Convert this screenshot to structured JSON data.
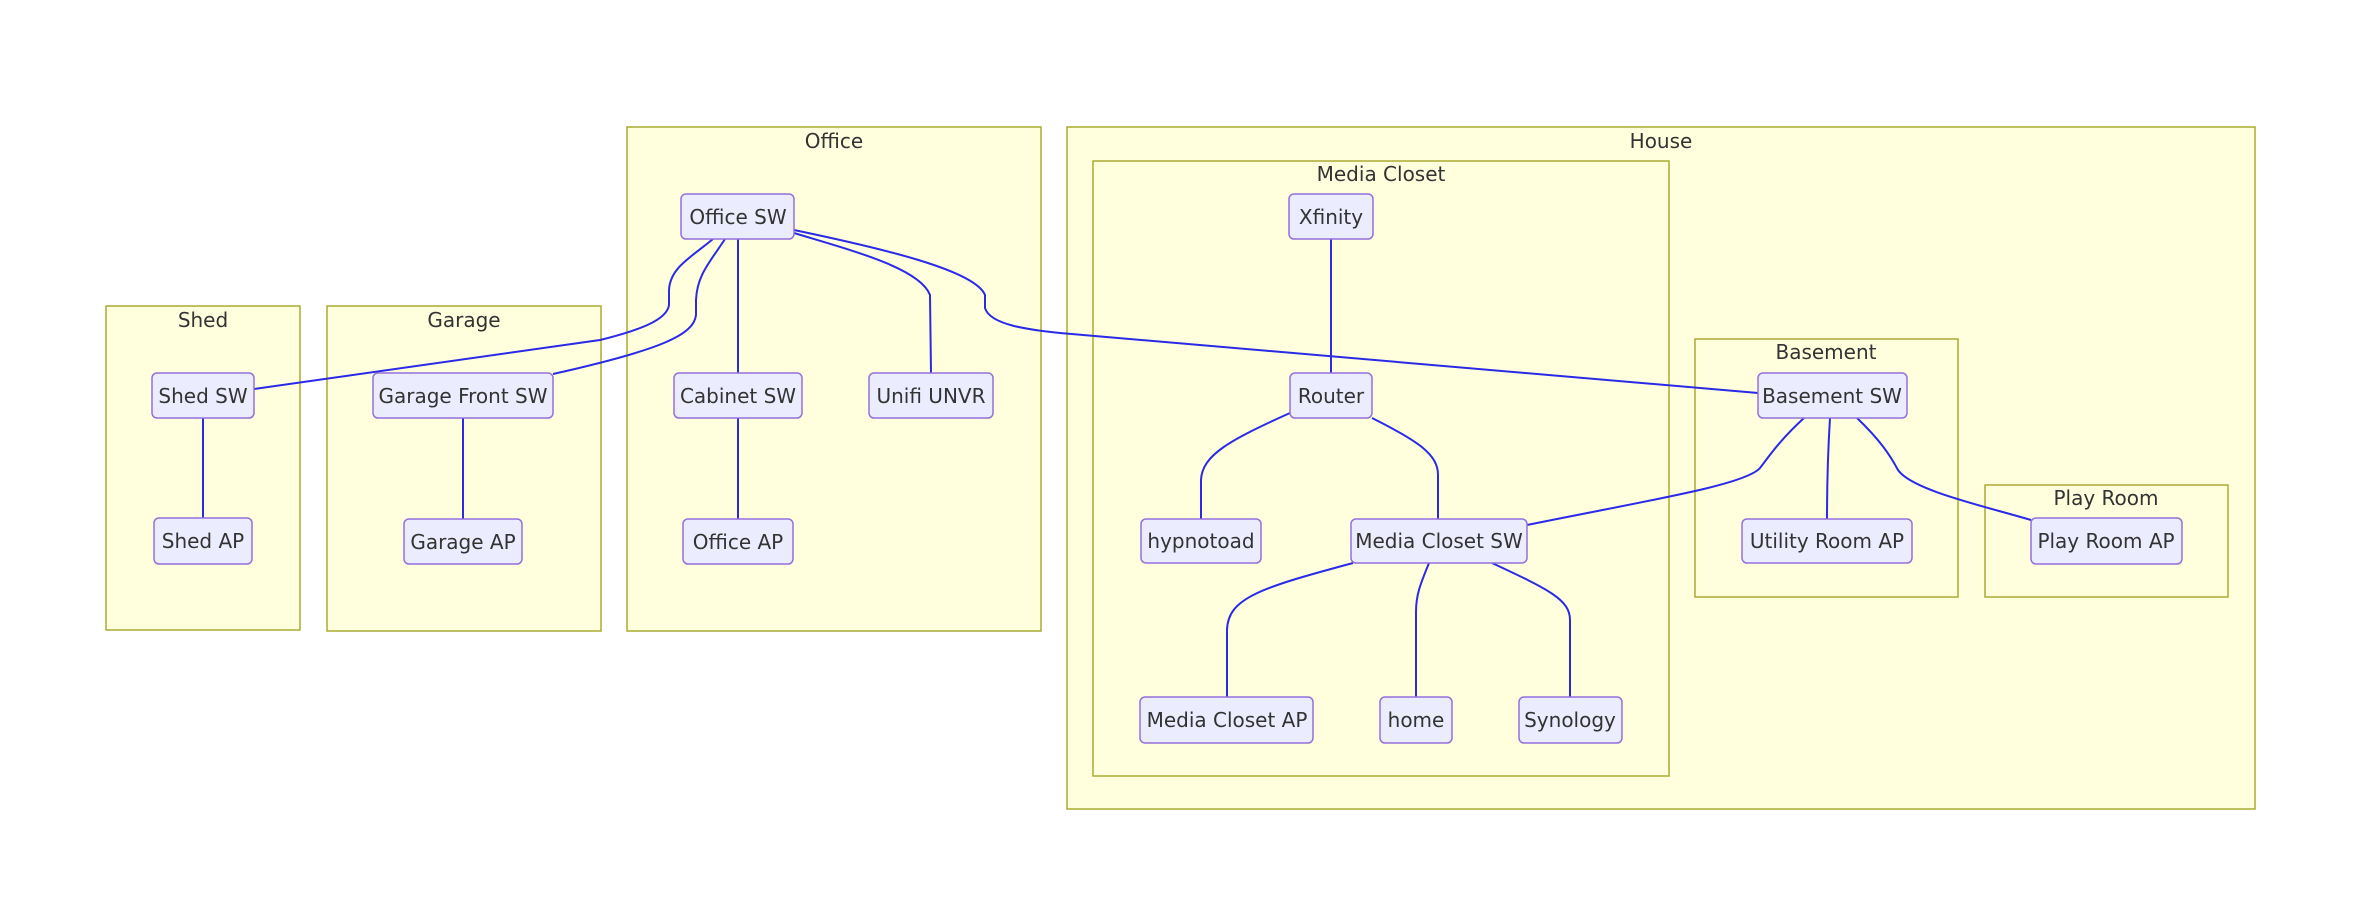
{
  "diagram": {
    "type": "flowchart",
    "colors": {
      "cluster_fill": "#ffffde",
      "cluster_stroke": "#aaaa33",
      "node_fill": "#ececff",
      "node_stroke": "#9370db",
      "edge": "#2a2ae6",
      "text": "#333333"
    },
    "clusters": {
      "shed": "Shed",
      "garage": "Garage",
      "office": "Office",
      "house": "House",
      "media_closet": "Media Closet",
      "basement": "Basement",
      "play_room": "Play Room"
    },
    "nodes": {
      "shed_sw": "Shed SW",
      "shed_ap": "Shed AP",
      "garage_front_sw": "Garage Front SW",
      "garage_ap": "Garage AP",
      "office_sw": "Office SW",
      "cabinet_sw": "Cabinet SW",
      "unifi_unvr": "Unifi UNVR",
      "office_ap": "Office AP",
      "xfinity": "Xfinity",
      "router": "Router",
      "hypnotoad": "hypnotoad",
      "media_closet_sw": "Media Closet SW",
      "media_closet_ap": "Media Closet AP",
      "home": "home",
      "synology": "Synology",
      "basement_sw": "Basement SW",
      "utility_room_ap": "Utility Room AP",
      "play_room_ap": "Play Room AP"
    },
    "edges": [
      {
        "from": "Office SW",
        "to": "Shed SW"
      },
      {
        "from": "Office SW",
        "to": "Garage Front SW"
      },
      {
        "from": "Office SW",
        "to": "Cabinet SW"
      },
      {
        "from": "Office SW",
        "to": "Unifi UNVR"
      },
      {
        "from": "Office SW",
        "to": "Basement SW"
      },
      {
        "from": "Shed SW",
        "to": "Shed AP"
      },
      {
        "from": "Garage Front SW",
        "to": "Garage AP"
      },
      {
        "from": "Cabinet SW",
        "to": "Office AP"
      },
      {
        "from": "Xfinity",
        "to": "Router"
      },
      {
        "from": "Router",
        "to": "hypnotoad"
      },
      {
        "from": "Router",
        "to": "Media Closet SW"
      },
      {
        "from": "Media Closet SW",
        "to": "Media Closet AP"
      },
      {
        "from": "Media Closet SW",
        "to": "home"
      },
      {
        "from": "Media Closet SW",
        "to": "Synology"
      },
      {
        "from": "Basement SW",
        "to": "Media Closet SW"
      },
      {
        "from": "Basement SW",
        "to": "Utility Room AP"
      },
      {
        "from": "Basement SW",
        "to": "Play Room AP"
      }
    ]
  }
}
